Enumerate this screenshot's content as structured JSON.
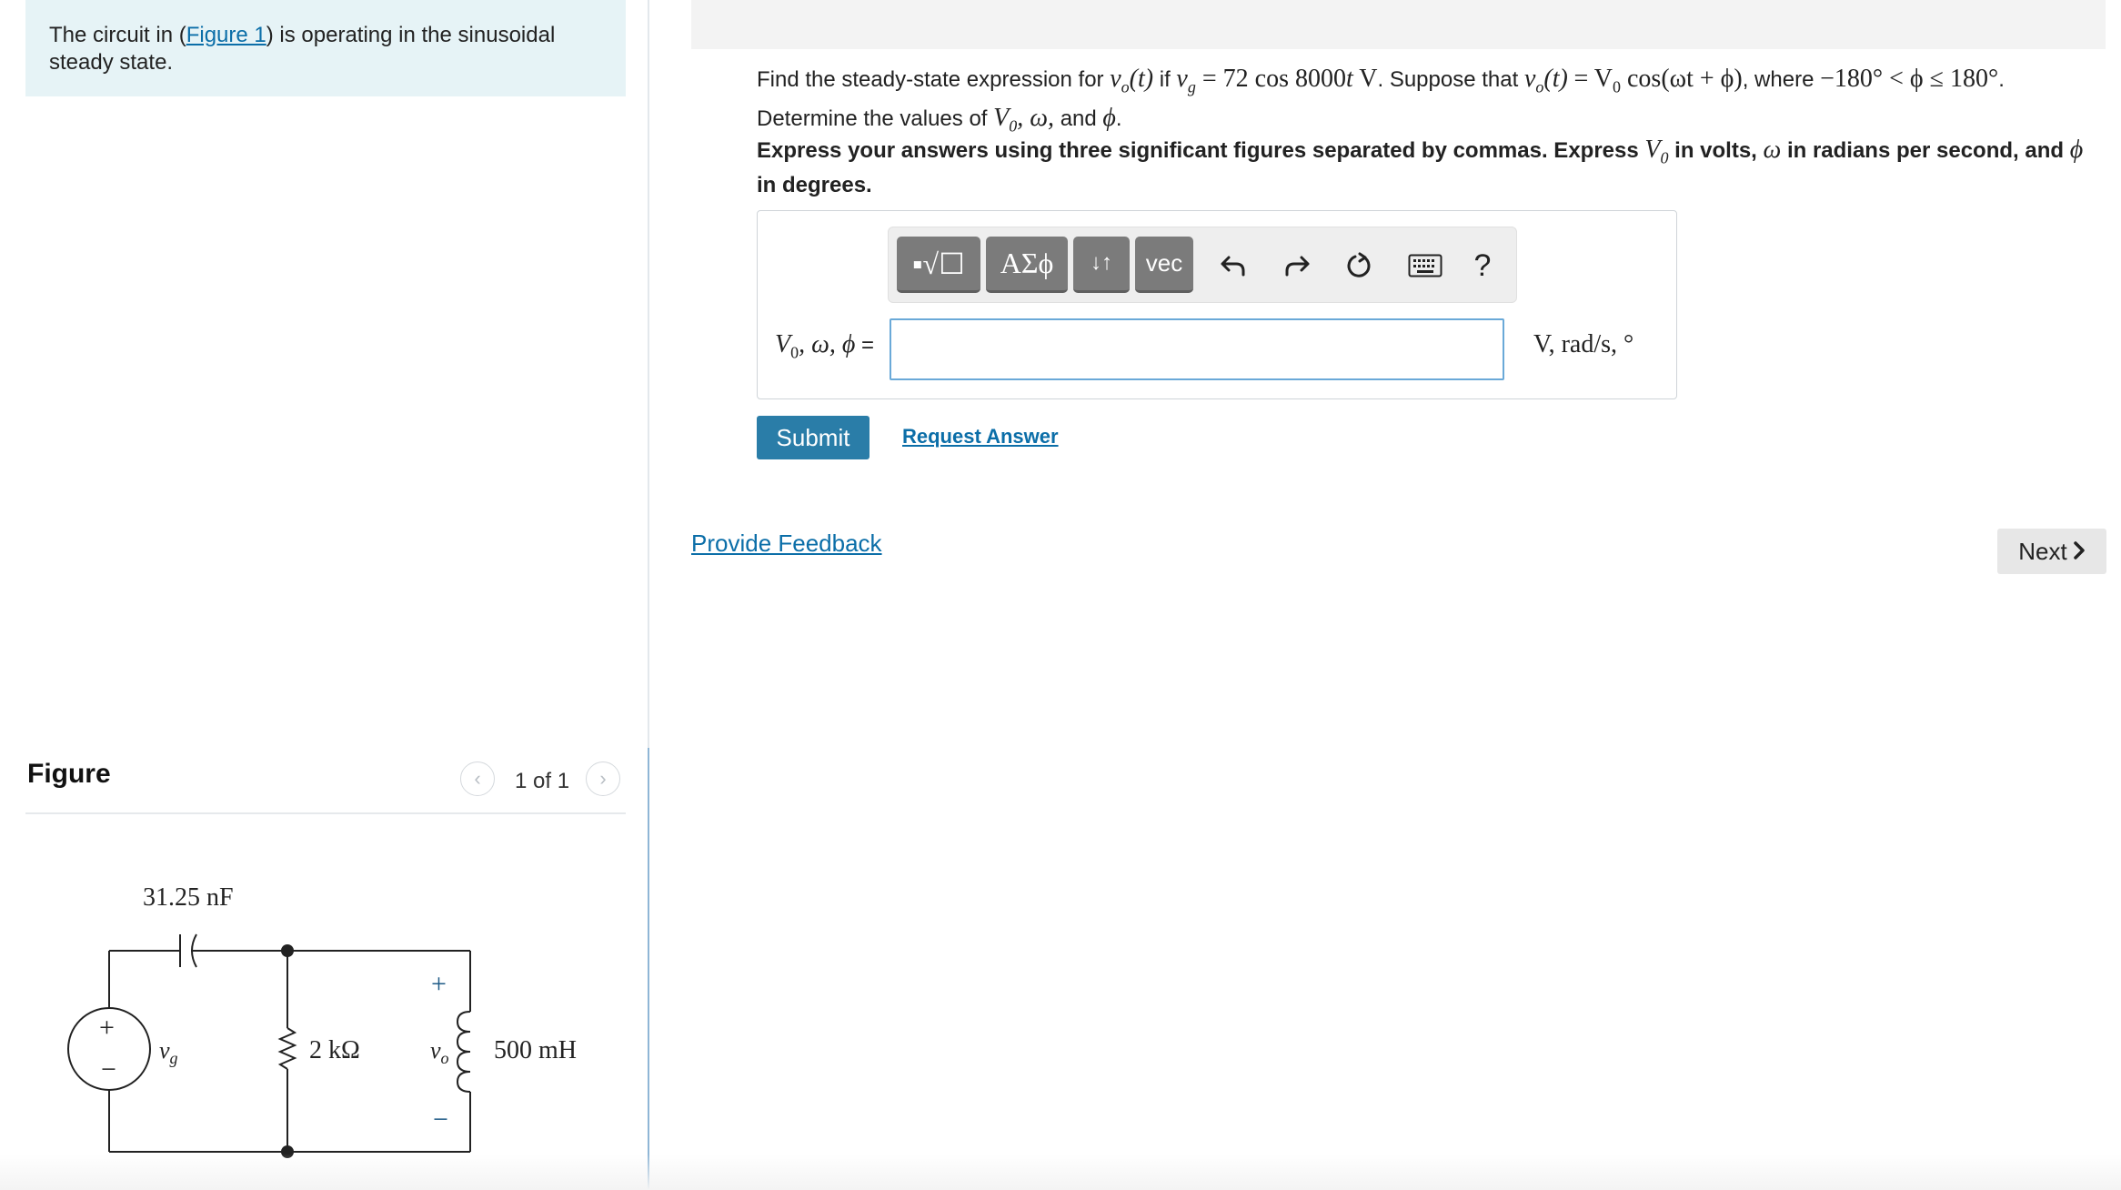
{
  "intro": {
    "before": "The circuit in (",
    "link": "Figure 1",
    "after": ") is operating in the sinusoidal steady state."
  },
  "figure": {
    "title": "Figure",
    "counter": "1 of 1",
    "prev_icon": "chevron-left-icon",
    "next_icon": "chevron-right-icon",
    "circuit": {
      "capacitor": "31.25 nF",
      "resistor": "2 kΩ",
      "inductor": "500 mH",
      "source": "v",
      "source_sub": "g",
      "output": "v",
      "output_sub": "o",
      "plus": "+",
      "minus": "−"
    }
  },
  "question": {
    "p1": "Find the steady-state expression for ",
    "vo_t": "v",
    "vo_sub": "o",
    "vo_arg": "(t)",
    "p2": " if ",
    "vg": "v",
    "vg_sub": "g",
    "vg_eq": " = 72 cos 8000",
    "vg_t": "t",
    "vg_unit": " V",
    "p3": ". Suppose that ",
    "eq2": "= V",
    "eq2_sub": "0",
    "eq2_rest": " cos(ωt + ϕ)",
    "p4": ", where ",
    "range": "−180° < ϕ ≤ 180°",
    "p5": ". Determine the values of ",
    "vars": "V",
    "vars_sub": "0",
    "vars_rest": ", ω,",
    "p6": " and ",
    "phi": "ϕ",
    "p7": "."
  },
  "instruction": {
    "t1": "Express your answers using three significant figures separated by commas. Express ",
    "v0": "V",
    "v0_sub": "0",
    "t2": " in volts, ",
    "omega": "ω",
    "t3": " in radians per second, and ",
    "phi": "ϕ",
    "t4": " in degrees."
  },
  "toolbar": {
    "templates": "▪√☐",
    "greek": "ΑΣϕ",
    "arrows": "↓↑",
    "vec": "vec",
    "undo_icon": "undo-icon",
    "redo_icon": "redo-icon",
    "reset_icon": "reset-icon",
    "keyboard_icon": "keyboard-icon",
    "help": "?"
  },
  "answer": {
    "label": "V",
    "label_sub": "0",
    "label_rest": ", ω, ϕ",
    "label_eq": " =",
    "value": "",
    "placeholder": "",
    "units": "V, rad/s, °"
  },
  "actions": {
    "submit": "Submit",
    "request_answer": "Request Answer",
    "provide_feedback": "Provide Feedback",
    "next": "Next"
  },
  "colors": {
    "accent": "#2a7da8",
    "link": "#0b6ea8",
    "intro_bg": "#e6f3f6"
  }
}
